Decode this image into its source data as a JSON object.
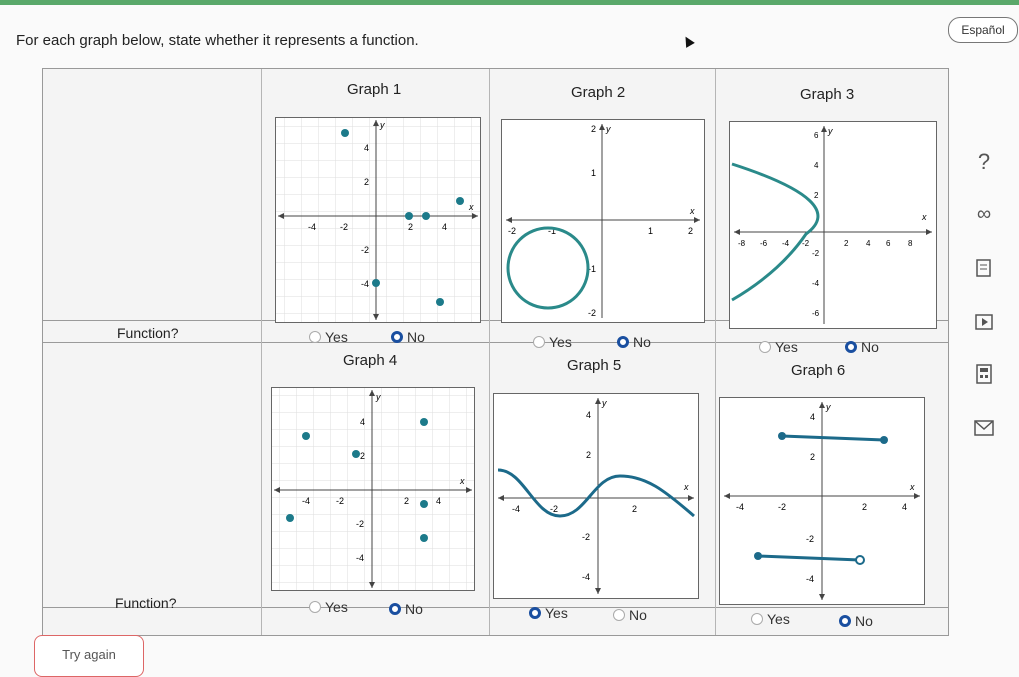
{
  "header": {
    "prompt": "For each graph below, state whether it represents a function.",
    "lang_button": "Español"
  },
  "table": {
    "function_label": "Function?",
    "graphs": [
      {
        "title": "Graph 1",
        "yes": "Yes",
        "no": "No",
        "selected": "no"
      },
      {
        "title": "Graph 2",
        "yes": "Yes",
        "no": "No",
        "selected": "no"
      },
      {
        "title": "Graph 3",
        "yes": "Yes",
        "no": "No",
        "selected": "no"
      },
      {
        "title": "Graph 4",
        "yes": "Yes",
        "no": "No",
        "selected": "no"
      },
      {
        "title": "Graph 5",
        "yes": "Yes",
        "no": "No",
        "selected": "yes"
      },
      {
        "title": "Graph 6",
        "yes": "Yes",
        "no": "No",
        "selected": "no"
      }
    ]
  },
  "graph_ticks": {
    "g1": {
      "x": [
        "-4",
        "-2",
        "2",
        "4"
      ],
      "y": [
        "4",
        "2",
        "-2",
        "-4"
      ],
      "xl": "x",
      "yl": "y"
    },
    "g2": {
      "x": [
        "-2",
        "-1",
        "1",
        "2"
      ],
      "y": [
        "2",
        "1",
        "-1",
        "-2"
      ],
      "xl": "x",
      "yl": "y"
    },
    "g3": {
      "x": [
        "-8",
        "-6",
        "-4",
        "-2",
        "2",
        "4",
        "6",
        "8"
      ],
      "y": [
        "6",
        "4",
        "2",
        "-2",
        "-4",
        "-6"
      ],
      "xl": "x",
      "yl": "y"
    },
    "g4": {
      "x": [
        "-4",
        "-2",
        "2",
        "4"
      ],
      "y": [
        "4",
        "2",
        "-2",
        "-4"
      ],
      "xl": "x",
      "yl": "y"
    },
    "g5": {
      "x": [
        "-4",
        "-2",
        "2"
      ],
      "y": [
        "4",
        "2",
        "-2",
        "-4"
      ],
      "xl": "x",
      "yl": "y"
    },
    "g6": {
      "x": [
        "-4",
        "-2",
        "2",
        "4"
      ],
      "y": [
        "4",
        "2",
        "-2",
        "-4"
      ],
      "xl": "x",
      "yl": "y"
    }
  },
  "colors": {
    "accent": "#1a4fa0",
    "curve": "#2a8a8a",
    "topbar": "#5aa86a"
  },
  "sidebar_tools": [
    "help-icon",
    "infinity-icon",
    "notes-icon",
    "video-icon",
    "calculator-icon",
    "mail-icon"
  ],
  "sidebar_glyphs": {
    "help": "?",
    "infinity": "∞"
  },
  "footer": {
    "try_again": "Try again"
  }
}
